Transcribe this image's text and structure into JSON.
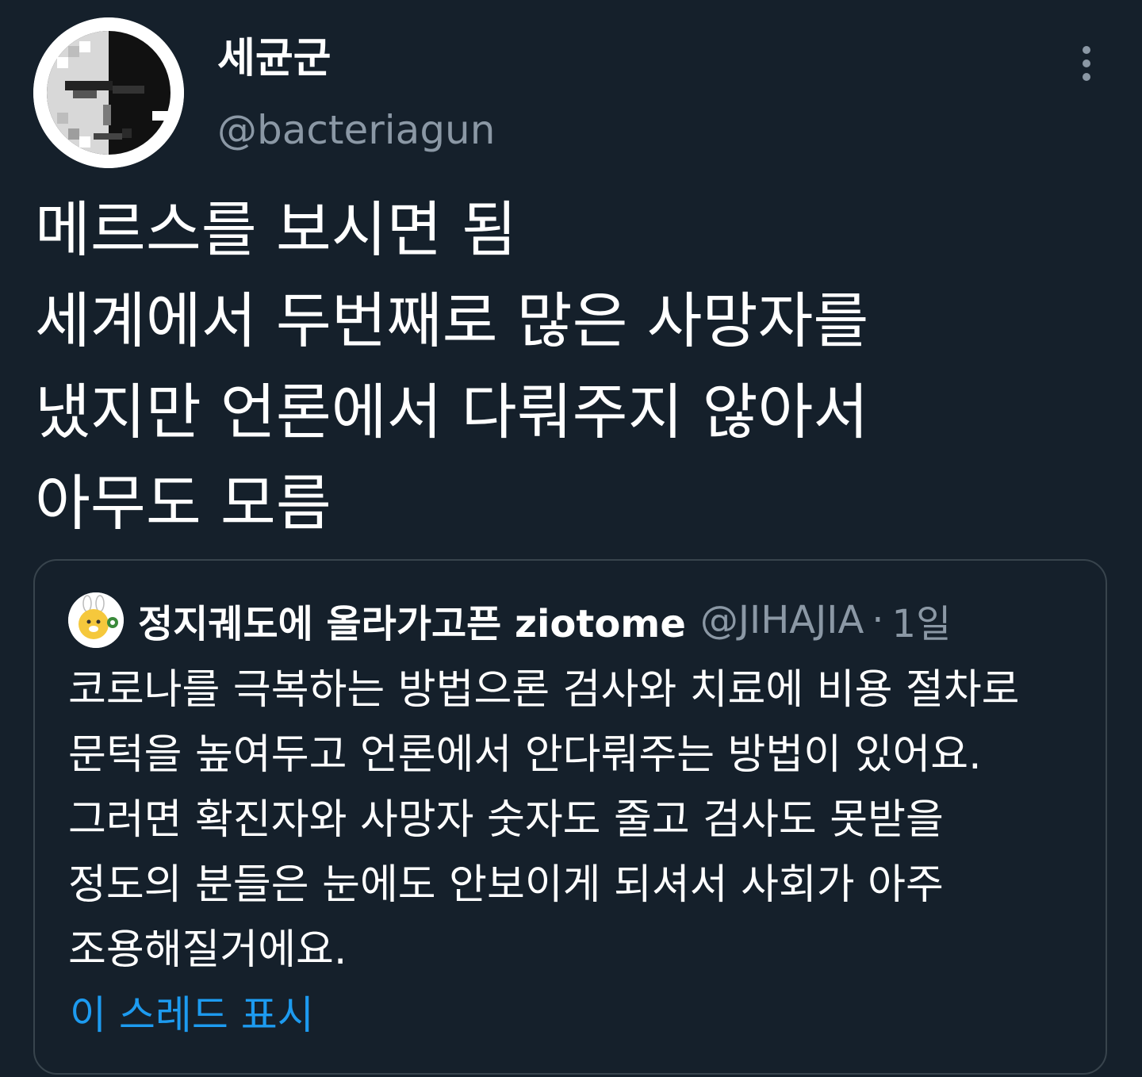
{
  "tweet": {
    "author": {
      "display_name": "세균군",
      "handle": "@bacteriagun",
      "avatar_icon": "pixel-face-avatar"
    },
    "more_icon": "more-vertical-icon",
    "text_lines": [
      "메르스를 보시면 됨",
      "세계에서 두번째로 많은 사망자를",
      "냈지만 언론에서 다뤄주지 않아서",
      "아무도 모름"
    ]
  },
  "quoted_tweet": {
    "author": {
      "display_name": "정지궤도에 올라가고픈 ziotome",
      "handle": "@JIHAJIA",
      "avatar_icon": "cartoon-character-avatar"
    },
    "separator": "·",
    "time": "1일",
    "text_lines": [
      "코로나를 극복하는 방법으론 검사와 치료에 비용 절차로",
      "문턱을 높여두고 언론에서 안다뤄주는 방법이 있어요.",
      "그러면 확진자와 사망자 숫자도 줄고 검사도 못받을",
      "정도의 분들은 눈에도 안보이게 되셔서 사회가 아주",
      "조용해질거에요."
    ],
    "show_thread_label": "이 스레드 표시"
  },
  "colors": {
    "background": "#15202b",
    "text_primary": "#ffffff",
    "text_secondary": "#8b98a5",
    "border": "#38444d",
    "link": "#1d9bf0"
  }
}
